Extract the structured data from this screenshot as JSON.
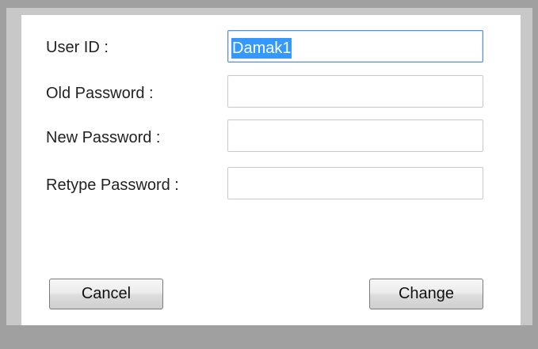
{
  "form": {
    "user_id_label": "User ID :",
    "user_id_value": "Damak1",
    "old_password_label": "Old Password :",
    "new_password_label": "New Password :",
    "retype_password_label": "Retype Password :"
  },
  "buttons": {
    "cancel_label": "Cancel",
    "change_label": "Change"
  },
  "colors": {
    "selection": "#3399ff",
    "focus_border": "#5b8fd6",
    "background": "#a0a0a0"
  }
}
